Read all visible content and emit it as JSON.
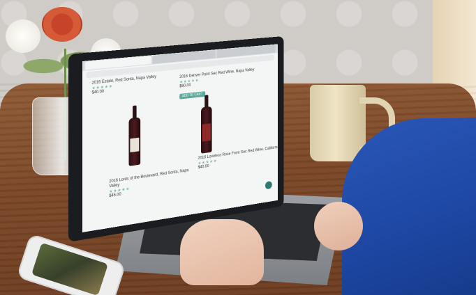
{
  "products": [
    {
      "title": "2016 Estate, Red Sonta, Napa Valley",
      "stars": "★★★★★",
      "price": "$40.00"
    },
    {
      "title": "2016 Denver Point Sec Red Wine, Napa Valley",
      "stars": "★★★★★",
      "price": "$60.00",
      "button": "ADD TO CART"
    },
    {
      "title": "2016 Lords of the Boulevard, Red Sonta, Napa Valley",
      "stars": "★★★★★",
      "price": "$45.00"
    },
    {
      "title": "2016 Loveless Rose From Sec Red Wine, California",
      "stars": "★★★★★",
      "price": "$40.00"
    }
  ],
  "colors": {
    "table": "#7a4626",
    "shirt": "#1d47a3",
    "accent_button": "#5aa99a"
  }
}
